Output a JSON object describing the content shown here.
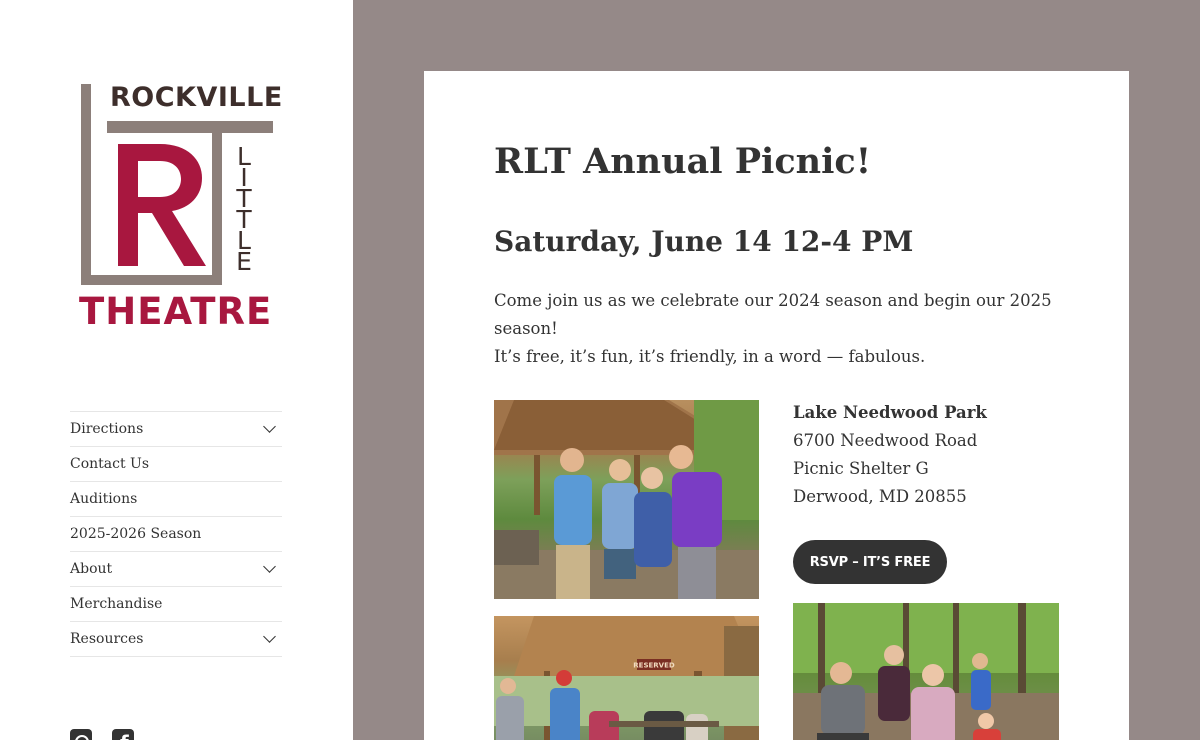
{
  "logo": {
    "top_text": "ROCKVILLE",
    "side_letters": [
      "L",
      "I",
      "T",
      "T",
      "L",
      "E"
    ],
    "bottom_text": "THEATRE",
    "monogram": "RT",
    "colors": {
      "dark": "#3d2e2b",
      "accent": "#a8173f",
      "bar": "#8c7f7a"
    }
  },
  "nav": {
    "items": [
      {
        "label": "Directions",
        "has_submenu": true
      },
      {
        "label": "Contact Us",
        "has_submenu": false
      },
      {
        "label": "Auditions",
        "has_submenu": false
      },
      {
        "label": "2025-2026 Season",
        "has_submenu": false
      },
      {
        "label": "About",
        "has_submenu": true
      },
      {
        "label": "Merchandise",
        "has_submenu": false
      },
      {
        "label": "Resources",
        "has_submenu": true
      }
    ]
  },
  "social": [
    "instagram-icon",
    "facebook-icon"
  ],
  "post": {
    "title": "RLT Annual Picnic!",
    "subtitle": "Saturday, June 14 12-4 PM",
    "intro_line1": "Come join us as we celebrate our 2024 season and begin our 2025 season!",
    "intro_line2": "It’s free, it’s fun, it’s friendly, in a word — fabulous.",
    "location": {
      "name": "Lake Needwood Park",
      "street": "6700 Needwood Road",
      "shelter": "Picnic Shelter G",
      "city": "Derwood, MD 20855"
    },
    "rsvp_label": "RSVP – IT’S FREE",
    "photo2_sign": "RESERVED"
  },
  "colors": {
    "page_bg": "#958988",
    "button_bg": "#333333",
    "text": "#333333"
  }
}
